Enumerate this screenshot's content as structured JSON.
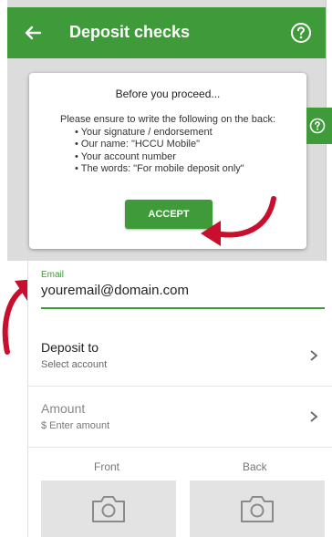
{
  "appbar": {
    "title": "Deposit checks",
    "back_icon": "arrow-left-icon",
    "help_icon": "help-circle-icon"
  },
  "dialog": {
    "title": "Before you proceed...",
    "intro": "Please ensure to write the following on the back:",
    "items": [
      "Your signature / endorsement",
      "Our name: \"HCCU Mobile\"",
      "Your account number",
      "The words: \"For mobile deposit only\""
    ],
    "accept_label": "ACCEPT"
  },
  "form": {
    "email_label": "Email",
    "email_value": "youremail@domain.com",
    "deposit_to": {
      "label": "Deposit to",
      "value": "Select account"
    },
    "amount": {
      "label": "Amount",
      "placeholder": "$ Enter amount"
    },
    "front_label": "Front",
    "back_label": "Back",
    "camera_icon": "camera-icon"
  },
  "colors": {
    "brand_green": "#3f9b3a",
    "annotation_red": "#c8102e"
  }
}
